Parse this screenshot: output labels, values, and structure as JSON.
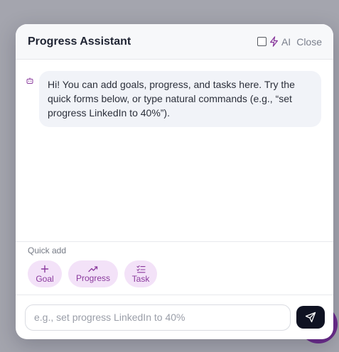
{
  "panel": {
    "title": "Progress Assistant",
    "ai_label": "AI",
    "ai_enabled": false,
    "close_label": "Close"
  },
  "messages": [
    {
      "role": "assistant",
      "text": "Hi! You can add goals, progress, and tasks here. Try the quick forms below, or type natural commands (e.g., “set progress LinkedIn to 40%”)."
    }
  ],
  "quick_add": {
    "label": "Quick add",
    "chips": [
      {
        "label": "Goal",
        "icon": "plus-icon"
      },
      {
        "label": "Progress",
        "icon": "trending-up-icon"
      },
      {
        "label": "Task",
        "icon": "list-checks-icon"
      }
    ]
  },
  "composer": {
    "placeholder": "e.g., set progress LinkedIn to 40%",
    "value": "",
    "send_icon": "send-icon"
  },
  "colors": {
    "accent": "#8a3a9d",
    "chip_bg": "#f3e2f8",
    "send_bg": "#0f1222",
    "launcher": "#6b2a8c"
  }
}
